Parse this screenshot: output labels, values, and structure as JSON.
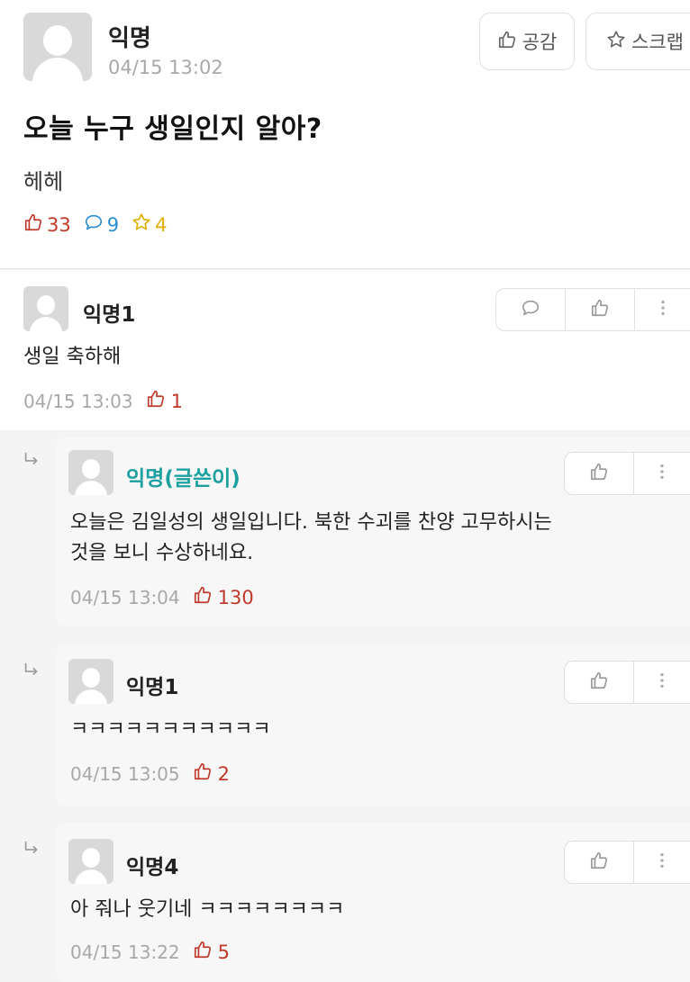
{
  "colors": {
    "like_red": "#c0392b",
    "comment_blue": "#2a8fd6",
    "scrap_yellow": "#e0b000",
    "op_teal": "#1ea0a0"
  },
  "post": {
    "author": "익명",
    "time": "04/15 13:02",
    "empathy_label": "공감",
    "scrap_label": "스크랩",
    "title": "오늘 누구 생일인지 알아?",
    "body": "헤헤",
    "like_count": "33",
    "comment_count": "9",
    "scrap_count": "4"
  },
  "comments": [
    {
      "author": "익명1",
      "text": "생일 축하해",
      "time": "04/15 13:03",
      "likes": "1"
    }
  ],
  "replies": [
    {
      "author": "익명(글쓴이)",
      "text_line1": "오늘은 김일성의 생일입니다. 북한 수괴를 찬양 고무하시는",
      "text_line2": "것을 보니 수상하네요.",
      "time": "04/15 13:04",
      "likes": "130"
    },
    {
      "author": "익명1",
      "text": "ㅋㅋㅋㅋㅋㅋㅋㅋㅋㅋㅋ",
      "time": "04/15 13:05",
      "likes": "2"
    },
    {
      "author": "익명4",
      "text": "아 줘나 웃기네 ㅋㅋㅋㅋㅋㅋㅋㅋ",
      "time": "04/15 13:22",
      "likes": "5"
    }
  ]
}
